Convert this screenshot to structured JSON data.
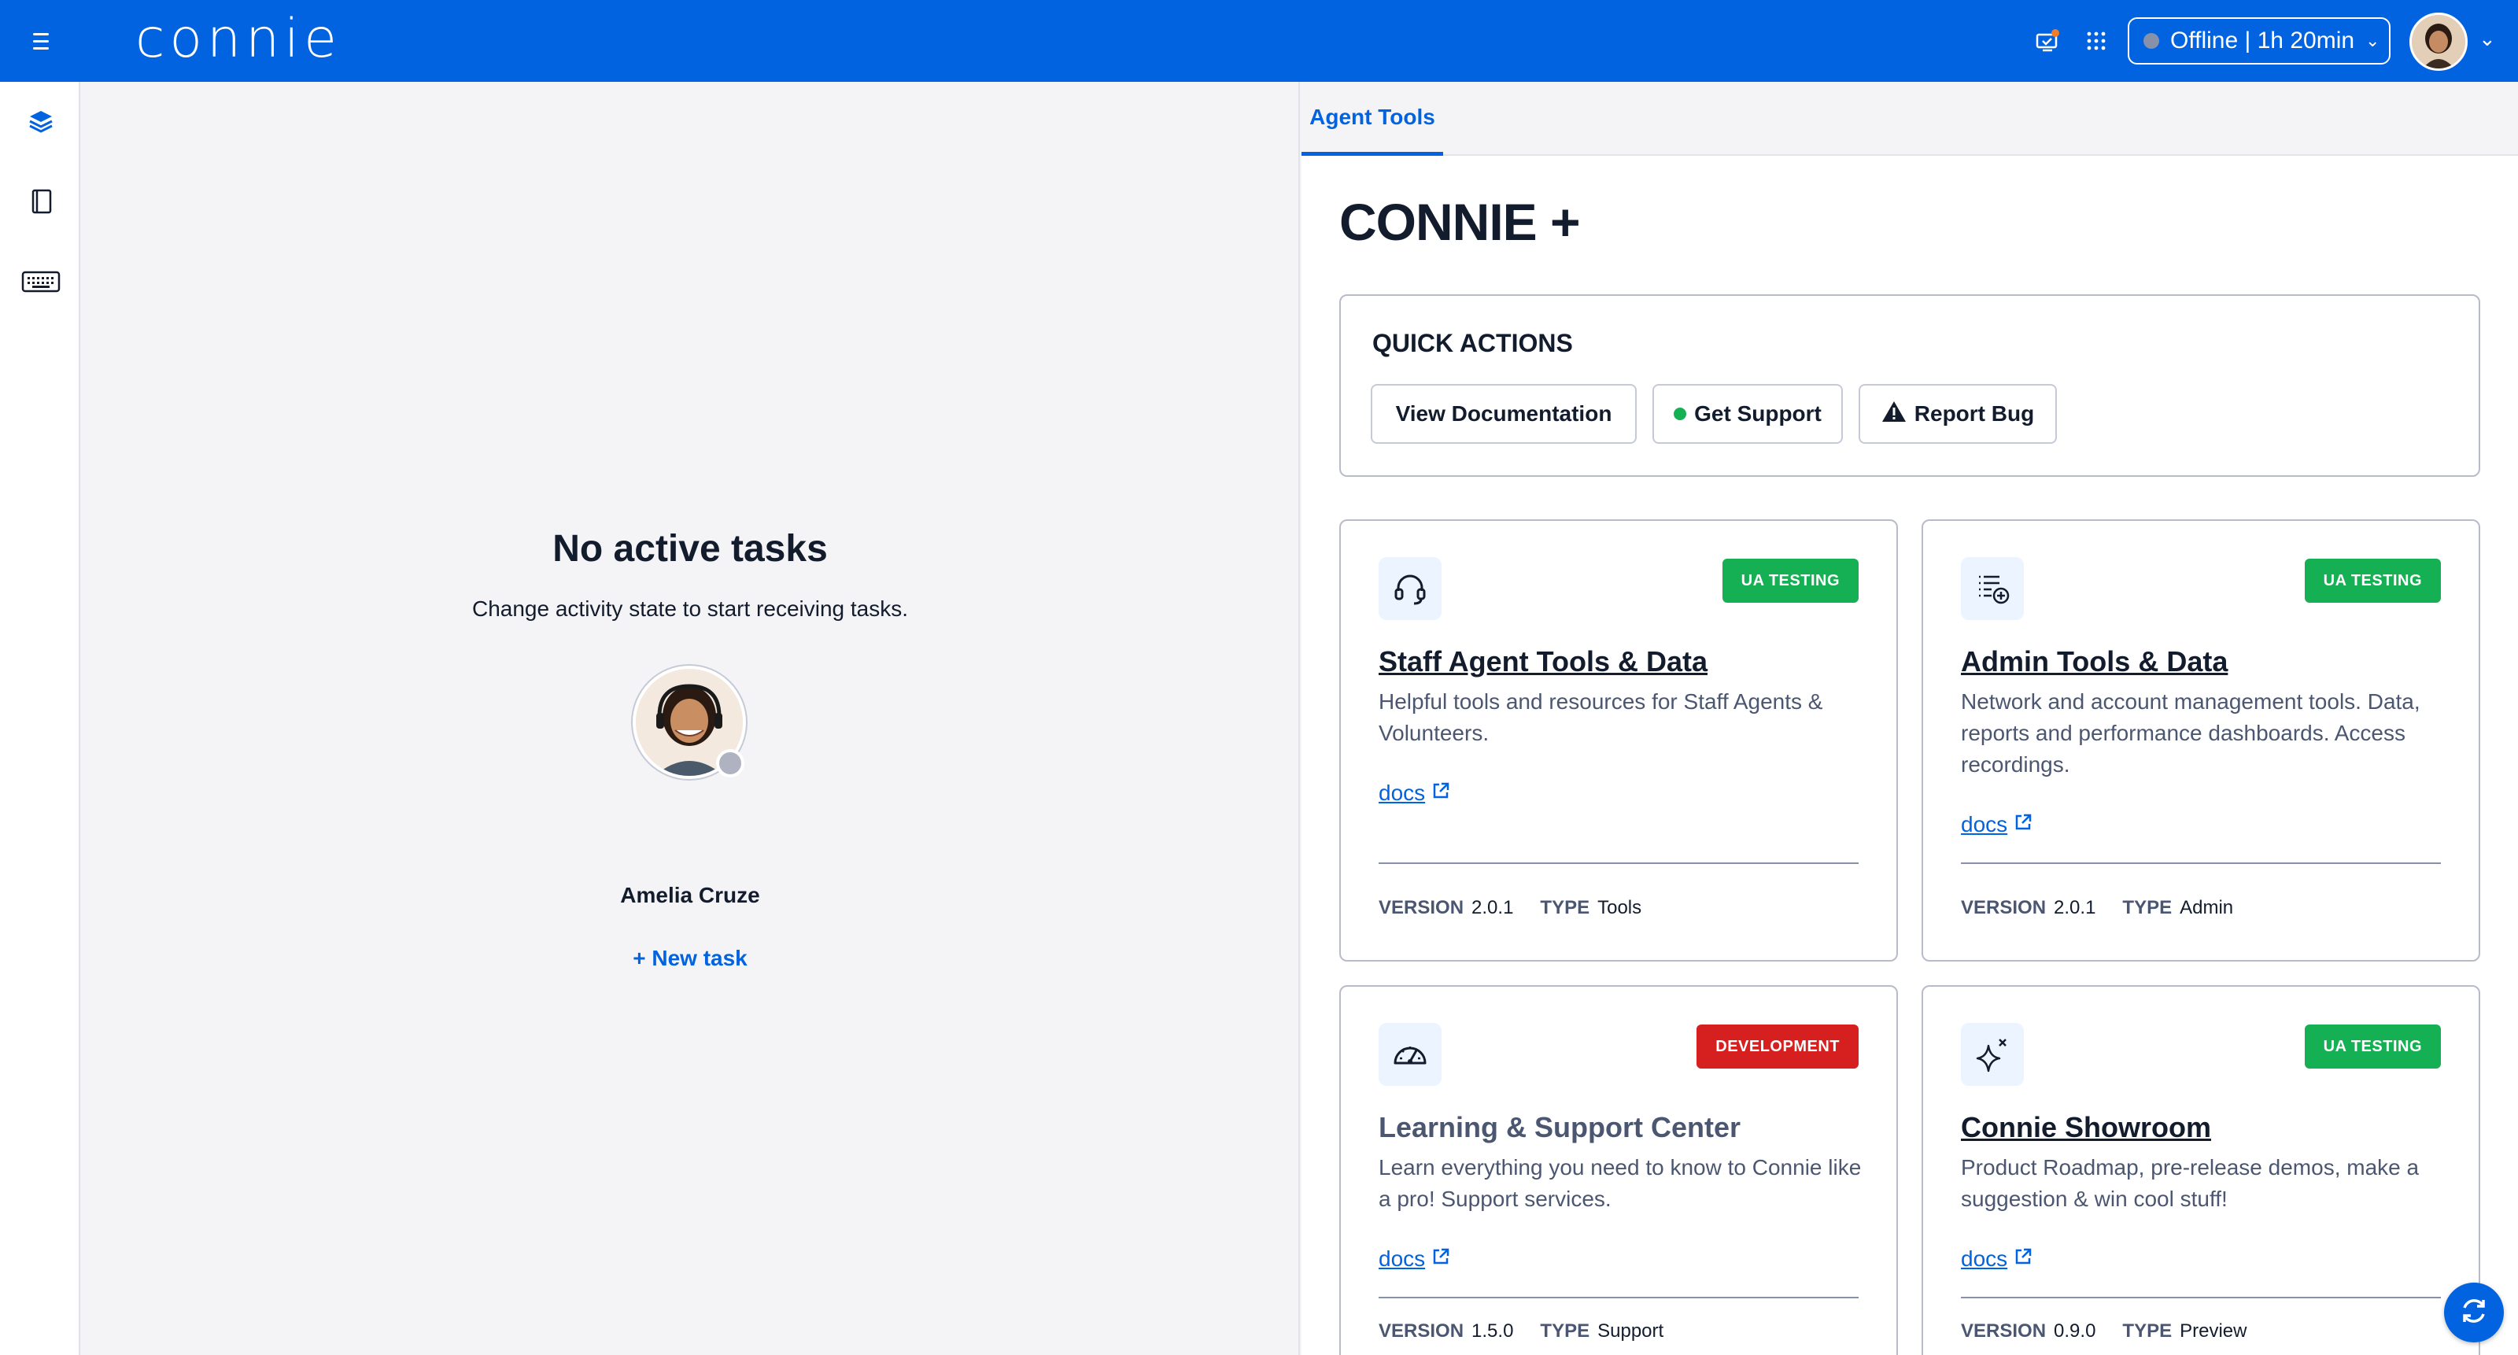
{
  "header": {
    "logo_text": "connie",
    "status_label": "Offline | 1h 20min"
  },
  "sidebar": {
    "items": [
      {
        "icon": "layers-icon"
      },
      {
        "icon": "notebook-icon"
      },
      {
        "icon": "keyboard-icon"
      }
    ]
  },
  "empty_state": {
    "title": "No active tasks",
    "subtitle": "Change activity state to start receiving tasks.",
    "agent_name": "Amelia Cruze",
    "new_task_label": "+ New task"
  },
  "tabs": [
    {
      "label": "Agent Tools",
      "active": true
    }
  ],
  "main": {
    "brand_title": "CONNIE +",
    "quick_actions": {
      "title": "QUICK ACTIONS",
      "buttons": [
        {
          "label": "View Documentation"
        },
        {
          "label": "Get Support"
        },
        {
          "label": "Report Bug"
        }
      ]
    },
    "cards": [
      {
        "title": "Staff Agent Tools & Data",
        "badge": "UA TESTING",
        "description": "Helpful tools and resources for Staff Agents & Volunteers.",
        "docs_label": "docs",
        "version_label": "VERSION",
        "version": "2.0.1",
        "type_label": "TYPE",
        "type": "Tools",
        "icon": "headset-icon"
      },
      {
        "title": "Admin Tools & Data",
        "badge": "UA TESTING",
        "description": "Network and account management tools. Data, reports and performance dashboards. Access recordings.",
        "docs_label": "docs",
        "version_label": "VERSION",
        "version": "2.0.1",
        "type_label": "TYPE",
        "type": "Admin",
        "icon": "list-add-icon"
      },
      {
        "title": "Learning & Support Center",
        "badge": "DEVELOPMENT",
        "description": "Learn everything you need to know to Connie like a pro! Support services.",
        "docs_label": "docs",
        "version_label": "VERSION",
        "version": "1.5.0",
        "type_label": "TYPE",
        "type": "Support",
        "icon": "gauge-icon"
      },
      {
        "title": "Connie Showroom",
        "badge": "UA TESTING",
        "description": "Product Roadmap, pre-release demos, make a suggestion & win cool stuff!",
        "docs_label": "docs",
        "version_label": "VERSION",
        "version": "0.9.0",
        "type_label": "TYPE",
        "type": "Preview",
        "icon": "sparkle-icon"
      }
    ]
  },
  "colors": {
    "brand_blue": "#0263e0",
    "badge_green": "#14b053",
    "badge_red": "#d61f1f",
    "offline_gray": "#8891aa"
  }
}
